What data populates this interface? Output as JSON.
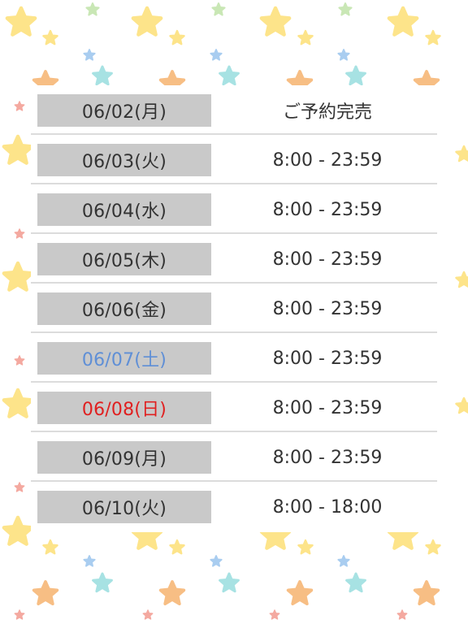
{
  "colors": {
    "weekday": "#333333",
    "saturday": "#5f8fd6",
    "sunday": "#e02020",
    "date_bg": "#c9c9c9",
    "divider": "#dcdcdc",
    "star_yellow": "#fde48a",
    "star_orange": "#f7be84",
    "star_blue": "#a9cdf0",
    "star_teal": "#a7e2e3",
    "star_green": "#c9e7b5",
    "star_pink": "#f4a9a0"
  },
  "schedule": [
    {
      "date": "06/02(月)",
      "time": "ご予約完売",
      "day_type": "weekday"
    },
    {
      "date": "06/03(火)",
      "time": "8:00 - 23:59",
      "day_type": "weekday"
    },
    {
      "date": "06/04(水)",
      "time": "8:00 - 23:59",
      "day_type": "weekday"
    },
    {
      "date": "06/05(木)",
      "time": "8:00 - 23:59",
      "day_type": "weekday"
    },
    {
      "date": "06/06(金)",
      "time": "8:00 - 23:59",
      "day_type": "weekday"
    },
    {
      "date": "06/07(土)",
      "time": "8:00 - 23:59",
      "day_type": "saturday"
    },
    {
      "date": "06/08(日)",
      "time": "8:00 - 23:59",
      "day_type": "sunday"
    },
    {
      "date": "06/09(月)",
      "time": "8:00 - 23:59",
      "day_type": "weekday"
    },
    {
      "date": "06/10(火)",
      "time": "8:00 - 18:00",
      "day_type": "weekday"
    }
  ]
}
